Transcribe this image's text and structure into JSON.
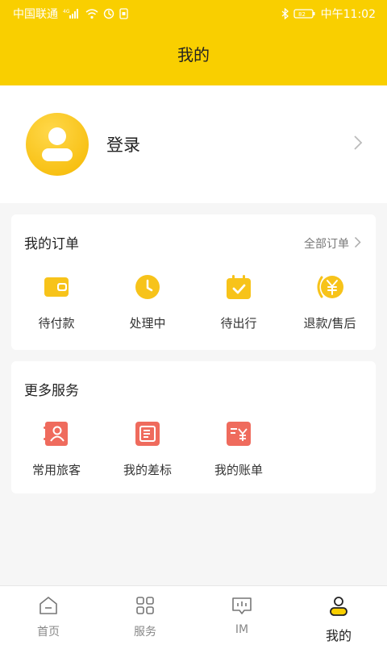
{
  "status_bar": {
    "carrier": "中国联通",
    "network": "4G",
    "battery": "82",
    "time": "中午11:02"
  },
  "header": {
    "title": "我的"
  },
  "profile": {
    "login_label": "登录"
  },
  "orders": {
    "title": "我的订单",
    "all_label": "全部订单",
    "items": [
      {
        "label": "待付款",
        "icon": "wallet-icon"
      },
      {
        "label": "处理中",
        "icon": "clock-icon"
      },
      {
        "label": "待出行",
        "icon": "calendar-check-icon"
      },
      {
        "label": "退款/售后",
        "icon": "refund-yen-icon"
      }
    ]
  },
  "services": {
    "title": "更多服务",
    "items": [
      {
        "label": "常用旅客",
        "icon": "contacts-book-icon"
      },
      {
        "label": "我的差标",
        "icon": "standard-doc-icon"
      },
      {
        "label": "我的账单",
        "icon": "bill-yen-icon"
      }
    ]
  },
  "tabbar": {
    "items": [
      {
        "label": "首页",
        "icon": "home-icon"
      },
      {
        "label": "服务",
        "icon": "grid-icon"
      },
      {
        "label": "IM",
        "icon": "chat-icon"
      },
      {
        "label": "我的",
        "icon": "user-icon",
        "active": true
      }
    ]
  },
  "colors": {
    "brand_yellow": "#f9cf00",
    "icon_yellow": "#f7c31a",
    "service_red": "#ef6b5d"
  }
}
